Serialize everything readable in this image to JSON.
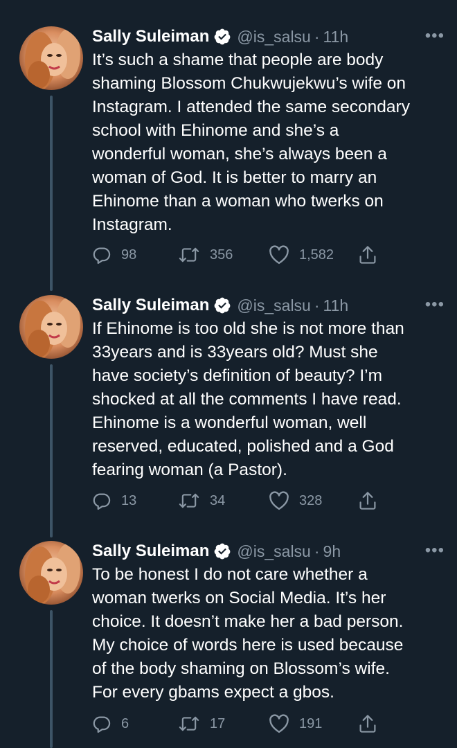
{
  "colors": {
    "background": "#15202b",
    "text_primary": "#ffffff",
    "text_secondary": "#8b98a5",
    "thread_line": "#3d5466",
    "verified_badge": "#ffffff"
  },
  "tweets": [
    {
      "name": "Sally Suleiman",
      "handle": "@is_salsu",
      "separator": "·",
      "time": "11h",
      "more_label": "•••",
      "lines": [
        "It’s such a shame that people are body",
        "shaming Blossom Chukwujekwu’s wife on",
        "Instagram. I attended the same secondary",
        "school with Ehinome and she’s a",
        "wonderful woman, she’s always been a",
        "woman of God. It is better to marry an",
        "Ehinome than a woman who twerks on",
        "Instagram."
      ],
      "replies": "98",
      "retweets": "356",
      "likes": "1,582"
    },
    {
      "name": "Sally Suleiman",
      "handle": "@is_salsu",
      "separator": "·",
      "time": "11h",
      "more_label": "•••",
      "lines": [
        "If Ehinome is too old she is not more than",
        "33years and is 33years old? Must she",
        "have society’s definition of beauty? I’m",
        "shocked at all the comments I have read.",
        "Ehinome is a wonderful woman, well",
        "reserved, educated, polished and a God",
        "fearing woman (a Pastor)."
      ],
      "replies": "13",
      "retweets": "34",
      "likes": "328"
    },
    {
      "name": "Sally Suleiman",
      "handle": "@is_salsu",
      "separator": "·",
      "time": "9h",
      "more_label": "•••",
      "lines": [
        "To be honest I do not care whether a",
        "woman twerks on Social Media. It’s her",
        "choice. It doesn’t make her a bad person.",
        "My choice of words here is used because",
        "of the body shaming on Blossom’s wife.",
        "For every gbams expect a gbos."
      ],
      "replies": "6",
      "retweets": "17",
      "likes": "191"
    }
  ],
  "icons": {
    "reply": "reply-icon",
    "retweet": "retweet-icon",
    "like": "heart-icon",
    "share": "share-icon",
    "verified": "verified-badge-icon",
    "more": "more-icon"
  }
}
